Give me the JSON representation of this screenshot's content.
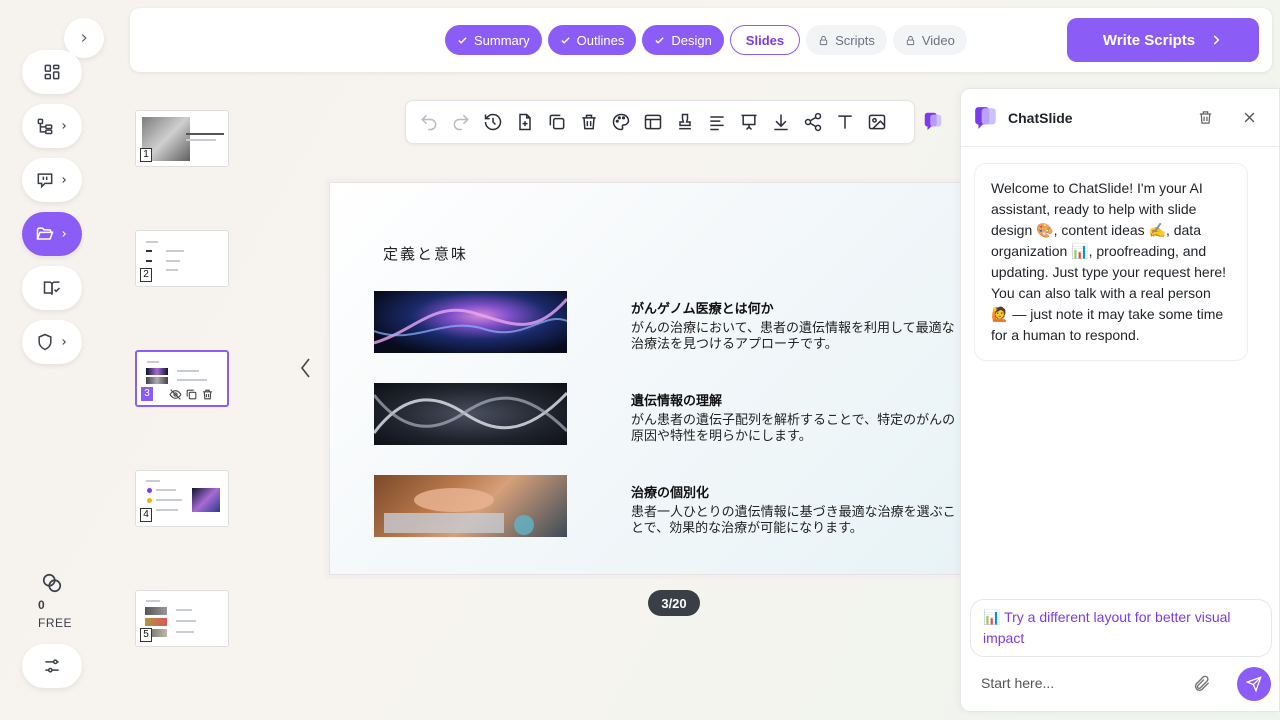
{
  "sidebar": {
    "items": [
      {
        "icon": "dashboard-icon"
      },
      {
        "icon": "hierarchy-icon"
      },
      {
        "icon": "chat-bubble-icon"
      },
      {
        "icon": "folder-open-icon",
        "active": true
      },
      {
        "icon": "book-check-icon"
      },
      {
        "icon": "shield-icon"
      }
    ],
    "credits_value": "0",
    "plan_label": "FREE"
  },
  "steps": [
    {
      "label": "Summary",
      "state": "done"
    },
    {
      "label": "Outlines",
      "state": "done"
    },
    {
      "label": "Design",
      "state": "done"
    },
    {
      "label": "Slides",
      "state": "current"
    },
    {
      "label": "Scripts",
      "state": "locked"
    },
    {
      "label": "Video",
      "state": "locked"
    }
  ],
  "write_scripts_label": "Write Scripts",
  "thumbnails": [
    "1",
    "2",
    "3",
    "4",
    "5"
  ],
  "slide": {
    "title": "定義と意味",
    "rows": [
      {
        "heading": "がんゲノム医療とは何か",
        "body": "がんの治療において、患者の遺伝情報を利用して最適な治療法を見つけるアプローチです。"
      },
      {
        "heading": "遺伝情報の理解",
        "body": "がん患者の遺伝子配列を解析することで、特定のがんの原因や特性を明らかにします。"
      },
      {
        "heading": "治療の個別化",
        "body": "患者一人ひとりの遺伝情報に基づき最適な治療を選ぶことで、効果的な治療が可能になります。"
      }
    ]
  },
  "page_indicator": "3/20",
  "chat": {
    "title": "ChatSlide",
    "welcome": "Welcome to ChatSlide! I'm your AI assistant, ready to help with slide design 🎨, content ideas ✍️, data organization 📊, proofreading, and updating. Just type your request here! You can also talk with a real person 🙋 — just note it may take some time for a human to respond.",
    "suggestion": "📊 Try a different layout for better visual impact",
    "input_placeholder": "Start here..."
  },
  "colors": {
    "accent": "#8b5cf6",
    "accent_dark": "#7c3aed"
  }
}
